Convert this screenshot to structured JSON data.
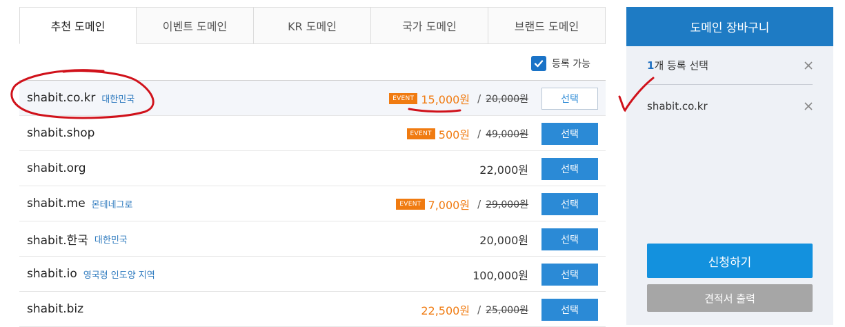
{
  "tabs": [
    {
      "label": "추천 도메인",
      "active": true
    },
    {
      "label": "이벤트 도메인",
      "active": false
    },
    {
      "label": "KR 도메인",
      "active": false
    },
    {
      "label": "국가 도메인",
      "active": false
    },
    {
      "label": "브랜드 도메인",
      "active": false
    }
  ],
  "filter": {
    "label": "등록 가능",
    "checked": true
  },
  "domains": [
    {
      "name": "shabit.co.kr",
      "country": "대한민국",
      "event": "EVENT",
      "price": "15,000원",
      "slash": "/",
      "original": "20,000원",
      "button": "선택",
      "selected": true
    },
    {
      "name": "shabit.shop",
      "country": "",
      "event": "EVENT",
      "price": "500원",
      "slash": "/",
      "original": "49,000원",
      "button": "선택",
      "selected": false
    },
    {
      "name": "shabit.org",
      "country": "",
      "event": "",
      "price": "22,000원",
      "slash": "",
      "original": "",
      "button": "선택",
      "selected": false
    },
    {
      "name": "shabit.me",
      "country": "몬테네그로",
      "event": "EVENT",
      "price": "7,000원",
      "slash": "/",
      "original": "29,000원",
      "button": "선택",
      "selected": false
    },
    {
      "name": "shabit.한국",
      "country": "대한민국",
      "event": "",
      "price": "20,000원",
      "slash": "",
      "original": "",
      "button": "선택",
      "selected": false
    },
    {
      "name": "shabit.io",
      "country": "영국령 인도양 지역",
      "event": "",
      "price": "100,000원",
      "slash": "",
      "original": "",
      "button": "선택",
      "selected": false
    },
    {
      "name": "shabit.biz",
      "country": "",
      "event": "",
      "price": "22,500원",
      "slash": "/",
      "original": "25,000원",
      "button": "선택",
      "selected": false,
      "sale_color": true
    }
  ],
  "cart": {
    "title": "도메인 장바구니",
    "count": "1",
    "count_suffix": "개 등록 선택",
    "item": "shabit.co.kr",
    "apply": "신청하기",
    "quote": "견적서 출력"
  },
  "colors": {
    "accent": "#1e7bc4",
    "sale": "#f07b11",
    "country": "#2f7bbf",
    "annotation": "#d0121b"
  }
}
